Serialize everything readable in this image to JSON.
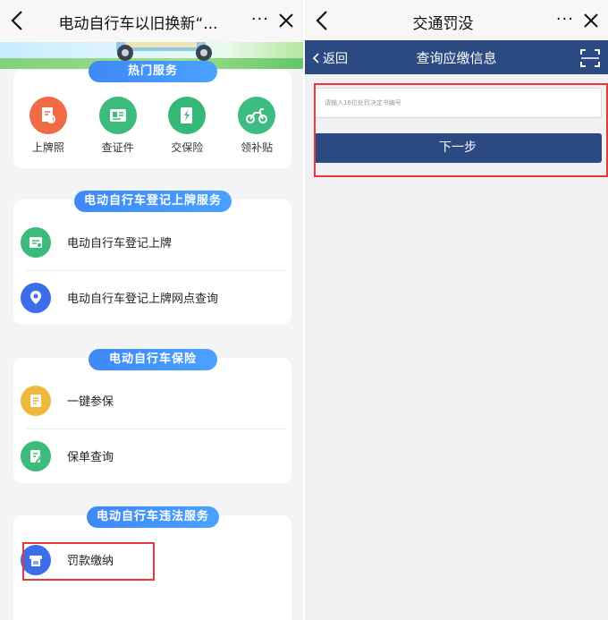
{
  "left": {
    "title": "电动自行车以旧换新“...",
    "more": "···",
    "hot": {
      "header": "热门服务",
      "items": [
        {
          "label": "上牌照",
          "color": "#ef6a45"
        },
        {
          "label": "查证件",
          "color": "#3dbb7c"
        },
        {
          "label": "交保险",
          "color": "#36b877"
        },
        {
          "label": "领补贴",
          "color": "#3dbd82"
        }
      ]
    },
    "register": {
      "header": "电动自行车登记上牌服务",
      "items": [
        {
          "label": "电动自行车登记上牌",
          "color": "#3dbb7c"
        },
        {
          "label": "电动自行车登记上牌网点查询",
          "color": "#3b6ee8"
        }
      ]
    },
    "insurance": {
      "header": "电动自行车保险",
      "items": [
        {
          "label": "一键参保",
          "color": "#f0b73e"
        },
        {
          "label": "保单查询",
          "color": "#3dbb7c"
        }
      ]
    },
    "violation": {
      "header": "电动自行车违法服务",
      "items": [
        {
          "label": "罚款缴纳",
          "color": "#3b6ee8"
        }
      ]
    }
  },
  "right": {
    "title": "交通罚没",
    "more": "···",
    "nav": {
      "back_label": "返回",
      "title": "查询应缴信息"
    },
    "form": {
      "input_placeholder": "请输入16位处罚决定书编号",
      "input_value": "",
      "next_label": "下一步"
    }
  },
  "colors": {
    "accent_blue": "#2b4a82",
    "pill_blue": "#3f88f7",
    "highlight_red": "#e8393a"
  }
}
